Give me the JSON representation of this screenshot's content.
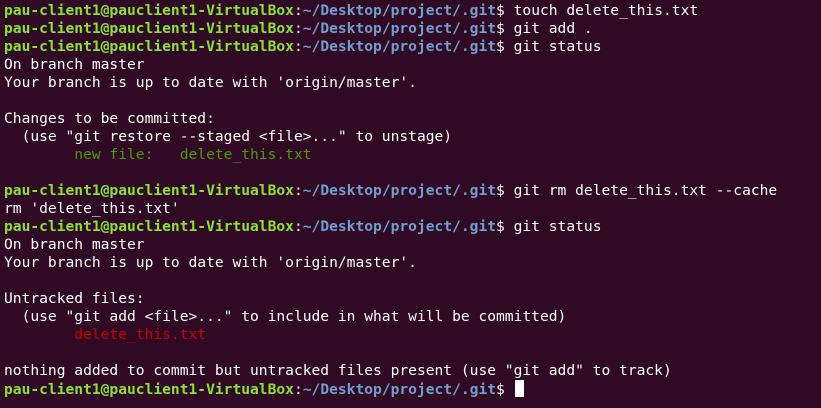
{
  "colors": {
    "background": "#300a24",
    "text": "#ffffff",
    "prompt_user": "#8ae234",
    "prompt_path": "#729fcf",
    "staged": "#4e9a06",
    "untracked": "#cc0000"
  },
  "prompt": {
    "user_host": "pau-client1@pauclient1-VirtualBox",
    "colon": ":",
    "path": "~/Desktop/project/.git",
    "symbol": "$"
  },
  "lines": [
    {
      "kind": "prompt",
      "command": " touch delete_this.txt"
    },
    {
      "kind": "prompt",
      "command": " git add ."
    },
    {
      "kind": "prompt",
      "command": " git status"
    },
    {
      "kind": "text",
      "text": "On branch master"
    },
    {
      "kind": "text",
      "text": "Your branch is up to date with 'origin/master'."
    },
    {
      "kind": "text",
      "text": ""
    },
    {
      "kind": "text",
      "text": "Changes to be committed:"
    },
    {
      "kind": "text",
      "text": "  (use \"git restore --staged <file>...\" to unstage)"
    },
    {
      "kind": "green",
      "text": "        new file:   delete_this.txt"
    },
    {
      "kind": "text",
      "text": ""
    },
    {
      "kind": "prompt",
      "command": " git rm delete_this.txt --cache"
    },
    {
      "kind": "text",
      "text": "rm 'delete_this.txt'"
    },
    {
      "kind": "prompt",
      "command": " git status"
    },
    {
      "kind": "text",
      "text": "On branch master"
    },
    {
      "kind": "text",
      "text": "Your branch is up to date with 'origin/master'."
    },
    {
      "kind": "text",
      "text": ""
    },
    {
      "kind": "text",
      "text": "Untracked files:"
    },
    {
      "kind": "text",
      "text": "  (use \"git add <file>...\" to include in what will be committed)"
    },
    {
      "kind": "red",
      "text": "        delete_this.txt"
    },
    {
      "kind": "text",
      "text": ""
    },
    {
      "kind": "text",
      "text": "nothing added to commit but untracked files present (use \"git add\" to track)"
    },
    {
      "kind": "prompt",
      "command": " ",
      "cursor": true
    }
  ]
}
